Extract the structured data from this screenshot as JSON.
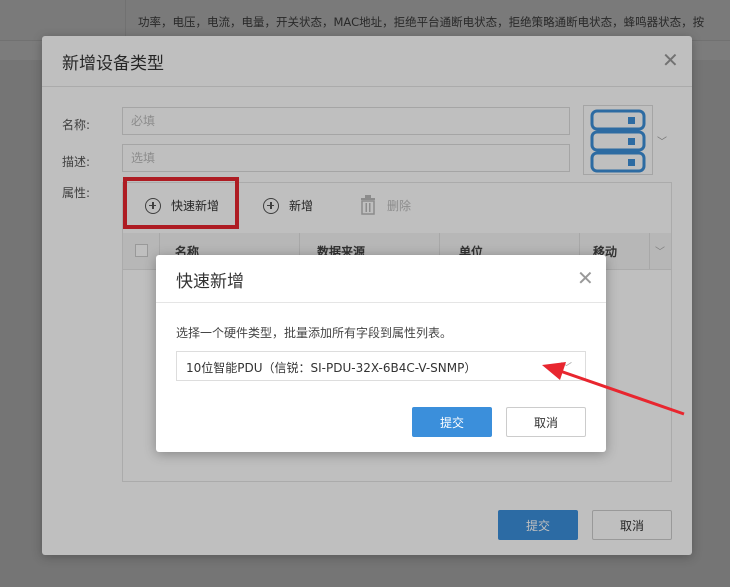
{
  "background": {
    "row_text": "功率，电压，电流，电量，开关状态，MAC地址，拒绝平台通断电状态，拒绝策略通断电状态，蜂鸣器状态，按"
  },
  "device_type_dialog": {
    "title": "新增设备类型",
    "name_label": "名称:",
    "name_placeholder": "必填",
    "desc_label": "描述:",
    "desc_placeholder": "选填",
    "attr_label": "属性:",
    "icon": "server-rack-icon",
    "toolbar": {
      "quick_add": "快速新增",
      "add": "新增",
      "delete": "删除"
    },
    "columns": [
      "名称",
      "数据来源",
      "单位",
      "移动"
    ],
    "submit": "提交",
    "cancel": "取消"
  },
  "quick_add_dialog": {
    "title": "快速新增",
    "description": "选择一个硬件类型，批量添加所有字段到属性列表。",
    "selected_hardware": "10位智能PDU（信锐：SI-PDU-32X-6B4C-V-SNMP）",
    "submit": "提交",
    "cancel": "取消"
  },
  "colors": {
    "primary": "#3b8fdb",
    "highlight": "#e8262f",
    "icon_blue": "#3d8fd9"
  }
}
